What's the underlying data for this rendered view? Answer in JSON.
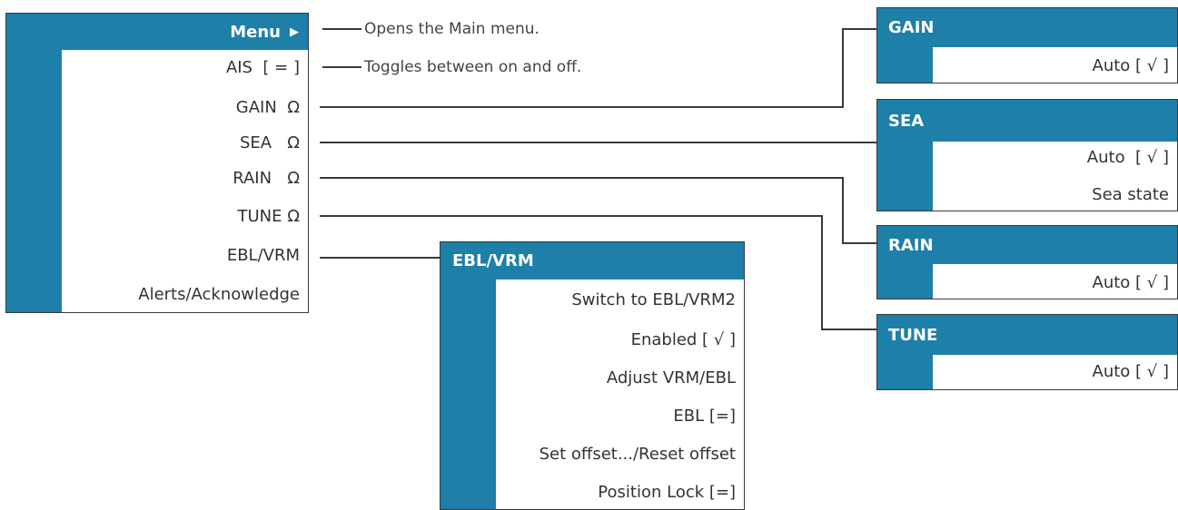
{
  "main_menu": {
    "title": "Menu",
    "title_arrow": "▶",
    "items": [
      {
        "label": "AIS  [ = ]"
      },
      {
        "label": "GAIN  Ω"
      },
      {
        "label": "SEA   Ω"
      },
      {
        "label": "RAIN   Ω"
      },
      {
        "label": "TUNE Ω"
      },
      {
        "label": "EBL/VRM"
      },
      {
        "label": "Alerts/Acknowledge"
      }
    ]
  },
  "callouts": {
    "menu": "Opens the Main menu.",
    "ais": "Toggles between on and off."
  },
  "ebl_panel": {
    "title": "EBL/VRM",
    "items": [
      {
        "label": "Switch to EBL/VRM2"
      },
      {
        "label": "Enabled [ √ ]"
      },
      {
        "label": "Adjust VRM/EBL"
      },
      {
        "label": "EBL [=]"
      },
      {
        "label": "Set offset.../Reset offset"
      },
      {
        "label": "Position Lock [=]"
      }
    ]
  },
  "gain_panel": {
    "title": "GAIN",
    "items": [
      {
        "label": "Auto [ √ ]"
      }
    ]
  },
  "sea_panel": {
    "title": "SEA",
    "items": [
      {
        "label": "Auto  [ √ ]"
      },
      {
        "label": "Sea state"
      }
    ]
  },
  "rain_panel": {
    "title": "RAIN",
    "items": [
      {
        "label": "Auto [ √ ]"
      }
    ]
  },
  "tune_panel": {
    "title": "TUNE",
    "items": [
      {
        "label": "Auto [ √ ]"
      }
    ]
  },
  "colors": {
    "accent": "#1e7fa8",
    "line": "#3a3a3a"
  }
}
